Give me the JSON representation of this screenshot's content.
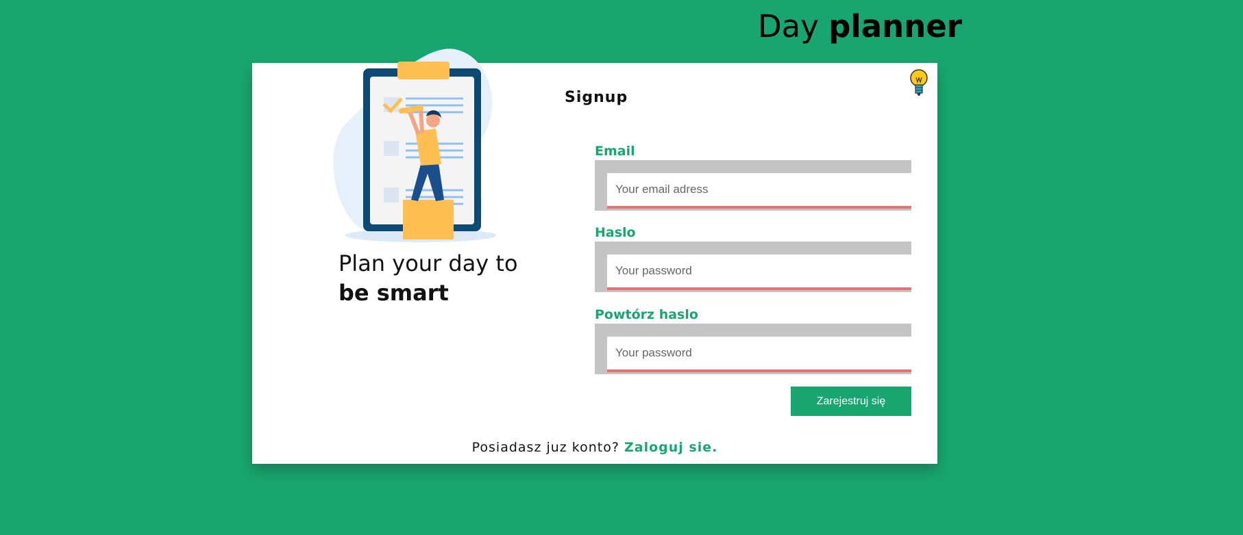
{
  "header": {
    "title_regular": "Day",
    "title_bold": "planner"
  },
  "hero": {
    "line1": "Plan your day to",
    "line2": "be smart"
  },
  "icons": {
    "illustration": "clipboard-person-illustration",
    "idea": "lightbulb-icon"
  },
  "form": {
    "title": "Signup",
    "email": {
      "label": "Email",
      "placeholder": "Your email adress",
      "value": ""
    },
    "password": {
      "label": "Haslo",
      "placeholder": "Your password",
      "value": ""
    },
    "repeat_password": {
      "label": "Powtórz haslo",
      "placeholder": "Your password",
      "value": ""
    },
    "submit_label": "Zarejestruj się"
  },
  "footer": {
    "prompt": "Posiadasz juz konto?",
    "link": "Zaloguj sie."
  },
  "colors": {
    "background": "#19a56f",
    "accent": "#19a56f",
    "input_error_border": "#e57373",
    "card": "#ffffff"
  }
}
